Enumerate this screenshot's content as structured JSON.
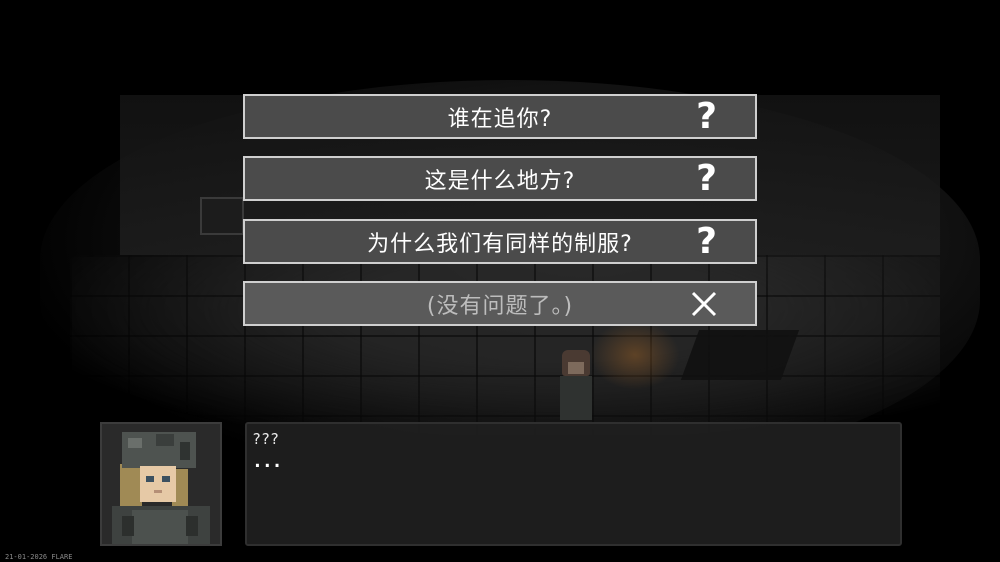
{
  "menu": {
    "choices": [
      {
        "label": "谁在追你?",
        "icon": "question-mark-icon"
      },
      {
        "label": "这是什么地方?",
        "icon": "question-mark-icon"
      },
      {
        "label": "为什么我们有同样的制服?",
        "icon": "question-mark-icon"
      },
      {
        "label": "(没有问题了。)",
        "icon": "close-icon"
      }
    ],
    "question_glyph": "?"
  },
  "dialog": {
    "speaker": "???",
    "text": "..."
  },
  "footer": {
    "watermark": "21-01-2026 FLARE"
  },
  "colors": {
    "choice_bg": "#4b4b4b",
    "choice_border": "#cfcfcf",
    "dialog_bg": "#202020"
  }
}
